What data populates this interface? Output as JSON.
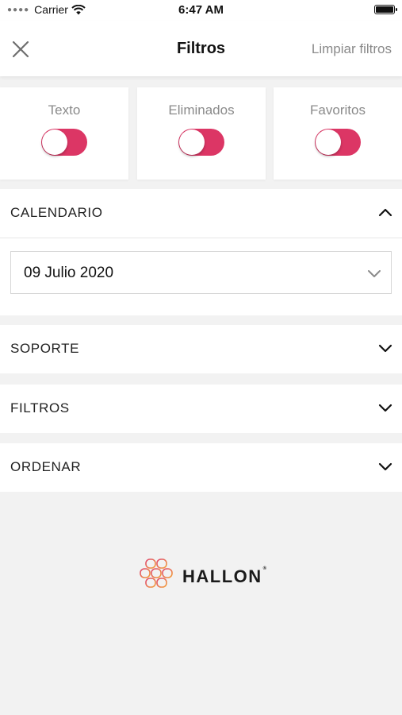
{
  "status_bar": {
    "carrier": "Carrier",
    "time": "6:47 AM"
  },
  "header": {
    "title": "Filtros",
    "clear_label": "Limpiar filtros"
  },
  "toggles": [
    {
      "label": "Texto",
      "on": true
    },
    {
      "label": "Eliminados",
      "on": true
    },
    {
      "label": "Favoritos",
      "on": true
    }
  ],
  "colors": {
    "accent": "#dc3665",
    "background": "#f2f2f2"
  },
  "sections": {
    "calendar": {
      "label": "CALENDARIO",
      "expanded": true,
      "selected_date": "09 Julio 2020"
    },
    "support": {
      "label": "SOPORTE",
      "expanded": false
    },
    "filters": {
      "label": "FILTROS",
      "expanded": false
    },
    "sort": {
      "label": "ORDENAR",
      "expanded": false
    }
  },
  "logo": {
    "brand": "HALLON"
  }
}
